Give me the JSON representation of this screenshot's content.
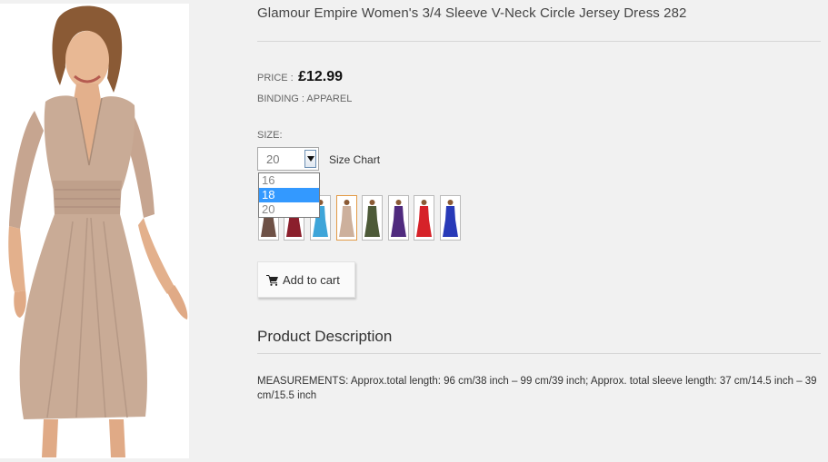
{
  "product": {
    "title": "Glamour Empire Women's 3/4 Sleeve V-Neck Circle Jersey Dress 282",
    "image_alt": "woman wearing beige v-neck dress"
  },
  "pricing": {
    "price_label": "PRICE :",
    "price_value": "£12.99",
    "binding_text": "BINDING : APPAREL"
  },
  "size": {
    "label": "SIZE:",
    "selected": "20",
    "options": [
      "16",
      "18",
      "20"
    ],
    "highlighted_option": "18",
    "size_chart_link": "Size Chart"
  },
  "colors": {
    "swatches": [
      {
        "name": "brown",
        "color": "#6e5146"
      },
      {
        "name": "burgundy",
        "color": "#8b1f2c"
      },
      {
        "name": "turquoise",
        "color": "#3ea5d9"
      },
      {
        "name": "beige",
        "color": "#cdb09c"
      },
      {
        "name": "olive",
        "color": "#4d5a38"
      },
      {
        "name": "purple",
        "color": "#4f2a7e"
      },
      {
        "name": "red",
        "color": "#d62229"
      },
      {
        "name": "royal-blue",
        "color": "#283ab8"
      }
    ],
    "selected_swatch": "beige"
  },
  "cart": {
    "button_label": "Add to cart",
    "icon": "cart-icon"
  },
  "description": {
    "heading": "Product Description",
    "text": "MEASUREMENTS: Approx.total length: 96 cm/38 inch – 99 cm/39 inch; Approx. total sleeve length: 37 cm/14.5 inch – 39 cm/15.5 inch"
  },
  "theme": {
    "background": "#f1f1f1",
    "dress_color": "#c9ab96",
    "highlight_blue": "#3399ff"
  }
}
